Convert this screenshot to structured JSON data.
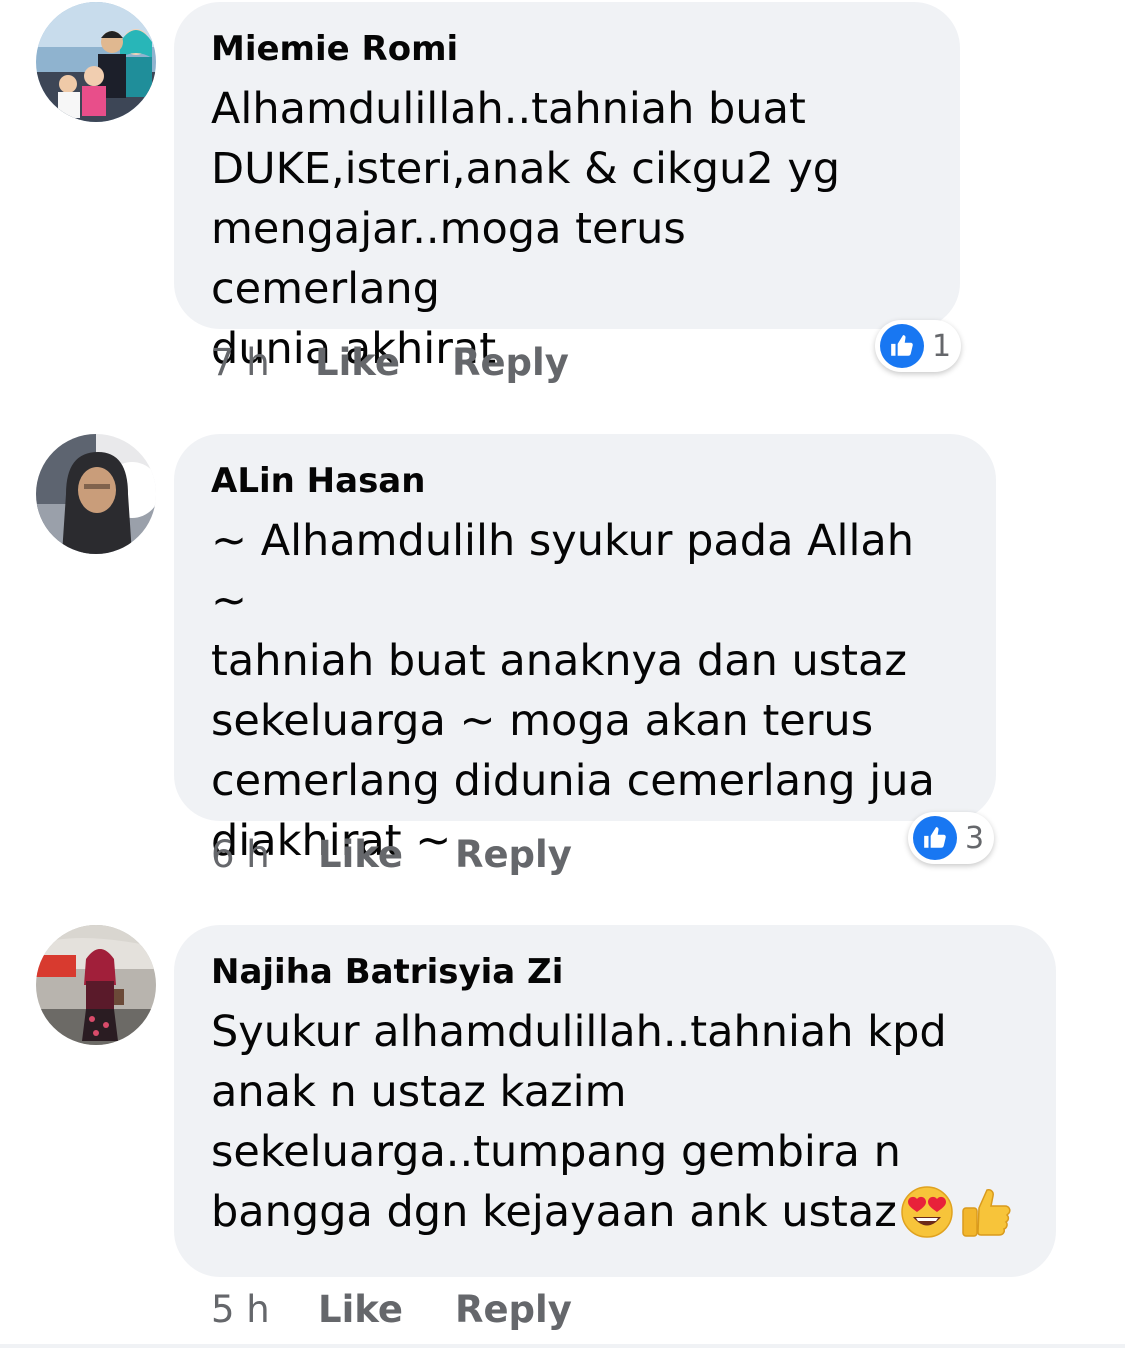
{
  "comments": [
    {
      "author": "Miemie Romi",
      "text": "Alhamdulillah..tahniah buat\nDUKE,isteri,anak & cikgu2 yg\nmengajar..moga terus cemerlang\ndunia akhirat",
      "time": "7 h",
      "like_label": "Like",
      "reply_label": "Reply",
      "reaction_icon": "like-icon",
      "reaction_count": "1"
    },
    {
      "author": "ALin Hasan",
      "text": "~ Alhamdulilh syukur pada  Allah ~\ntahniah buat anaknya dan ustaz\nsekeluarga ~ moga akan terus\ncemerlang didunia cemerlang jua\ndiakhirat ~",
      "time": "6 h",
      "like_label": "Like",
      "reply_label": "Reply",
      "reaction_icon": "like-icon",
      "reaction_count": "3"
    },
    {
      "author": "Najiha Batrisyia Zi",
      "text": "Syukur alhamdulillah..tahniah kpd\nanak n ustaz kazim\nsekeluarga..tumpang gembira n\nbangga dgn kejayaan ank ustaz",
      "text_emojis": [
        "heart-eyes-emoji",
        "thumbs-up-emoji"
      ],
      "time": "5 h",
      "like_label": "Like",
      "reply_label": "Reply"
    }
  ],
  "colors": {
    "bubble_bg": "#f0f2f5",
    "meta_text": "#65676b",
    "like_blue": "#1877f2",
    "text": "#050505"
  }
}
